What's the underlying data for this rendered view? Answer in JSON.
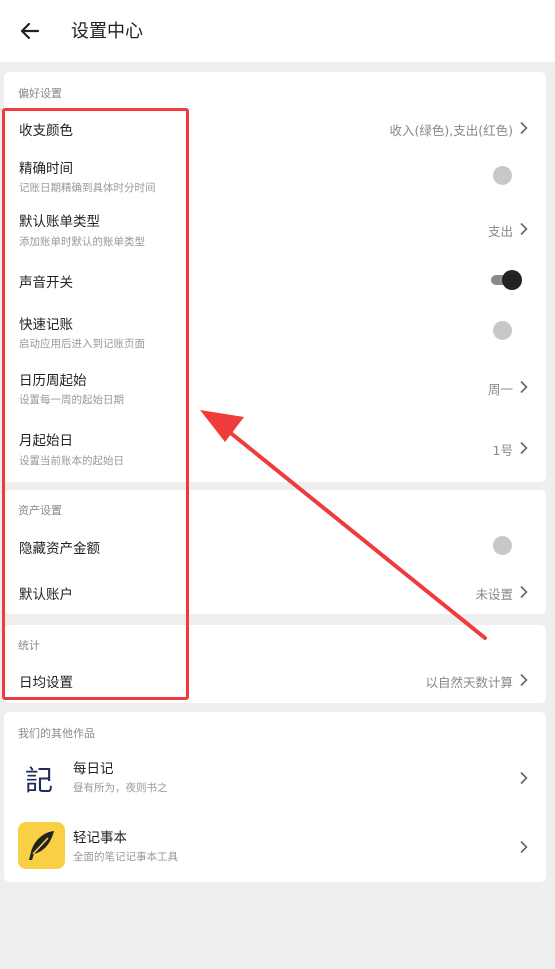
{
  "header": {
    "title": "设置中心"
  },
  "preferences": {
    "title": "偏好设置",
    "income_color": {
      "label": "收支颜色",
      "value": "收入(绿色),支出(红色)"
    },
    "precise_time": {
      "label": "精确时间",
      "sub": "记账日期精确到具体时分时间"
    },
    "default_type": {
      "label": "默认账单类型",
      "sub": "添加账单时默认的账单类型",
      "value": "支出"
    },
    "sound": {
      "label": "声音开关"
    },
    "quick_entry": {
      "label": "快速记账",
      "sub": "启动应用后进入到记账页面"
    },
    "week_start": {
      "label": "日历周起始",
      "sub": "设置每一周的起始日期",
      "value": "周一"
    },
    "month_start": {
      "label": "月起始日",
      "sub": "设置当前账本的起始日",
      "value": "1号"
    }
  },
  "assets": {
    "title": "资产设置",
    "hide_amount": {
      "label": "隐藏资产金额"
    },
    "default_account": {
      "label": "默认账户",
      "value": "未设置"
    }
  },
  "stats": {
    "title": "统计",
    "daily_avg": {
      "label": "日均设置",
      "value": "以自然天数计算"
    }
  },
  "other_works": {
    "title": "我们的其他作品",
    "apps": [
      {
        "name": "每日记",
        "desc": "昼有所为，夜则书之",
        "icon_glyph": "記"
      },
      {
        "name": "轻记事本",
        "desc": "全面的笔记记事本工具"
      }
    ]
  },
  "colors": {
    "highlight": "#ef3b3b",
    "note_icon_bg": "#f8cf45"
  }
}
